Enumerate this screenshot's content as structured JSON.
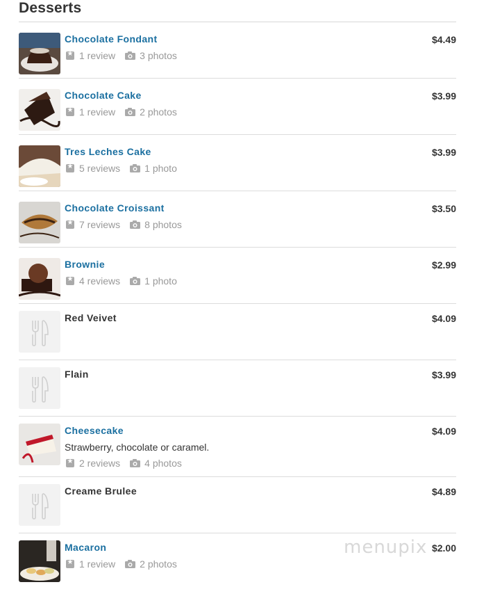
{
  "section": {
    "title": "Desserts"
  },
  "watermark": "menupix",
  "colors": {
    "link": "#1a6fa0",
    "meta": "#999999",
    "divider": "#dcdcdc"
  },
  "items": [
    {
      "name": "Chocolate Fondant",
      "linked": true,
      "price": "$4.49",
      "reviews": "1 review",
      "photos": "3 photos",
      "thumb": "chocolate-fondant-photo"
    },
    {
      "name": "Chocolate Cake",
      "linked": true,
      "price": "$3.99",
      "reviews": "1 review",
      "photos": "2 photos",
      "thumb": "chocolate-cake-photo"
    },
    {
      "name": "Tres Leches Cake",
      "linked": true,
      "price": "$3.99",
      "reviews": "5 reviews",
      "photos": "1 photo",
      "thumb": "tres-leches-photo"
    },
    {
      "name": "Chocolate Croissant",
      "linked": true,
      "price": "$3.50",
      "reviews": "7 reviews",
      "photos": "8 photos",
      "thumb": "croissant-photo"
    },
    {
      "name": "Brownie",
      "linked": true,
      "price": "$2.99",
      "reviews": "4 reviews",
      "photos": "1 photo",
      "thumb": "brownie-photo"
    },
    {
      "name": "Red Veivet",
      "linked": false,
      "price": "$4.09",
      "thumb": "fork-knife-placeholder-icon"
    },
    {
      "name": "Flain",
      "linked": false,
      "price": "$3.99",
      "thumb": "fork-knife-placeholder-icon"
    },
    {
      "name": "Cheesecake",
      "linked": true,
      "price": "$4.09",
      "description": "Strawberry, chocolate or caramel.",
      "reviews": "2 reviews",
      "photos": "4 photos",
      "thumb": "cheesecake-photo"
    },
    {
      "name": "Creame Brulee",
      "linked": false,
      "price": "$4.89",
      "thumb": "fork-knife-placeholder-icon"
    },
    {
      "name": "Macaron",
      "linked": true,
      "price": "$2.00",
      "reviews": "1 review",
      "photos": "2 photos",
      "thumb": "macaron-photo"
    }
  ]
}
